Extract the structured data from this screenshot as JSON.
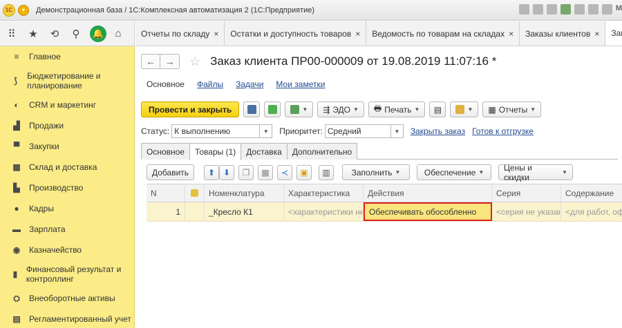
{
  "window": {
    "title": "Демонстрационная база / 1С:Комплексная автоматизация 2 (1С:Предприятие)",
    "logo_text": "1С",
    "tool_letter": "M"
  },
  "tabs": [
    {
      "label": "Отчеты по складу"
    },
    {
      "label": "Остатки и доступность товаров"
    },
    {
      "label": "Ведомость по товарам на складах"
    },
    {
      "label": "Заказы клиентов"
    },
    {
      "label": "Заказ клие"
    }
  ],
  "tab_close": "×",
  "sidebar": {
    "items": [
      {
        "label": "Главное",
        "icon": "≡"
      },
      {
        "label": "Бюджетирование и планирование",
        "icon": "⟆"
      },
      {
        "label": "CRM и маркетинг",
        "icon": "◐"
      },
      {
        "label": "Продажи",
        "icon": "▟"
      },
      {
        "label": "Закупки",
        "icon": "▀"
      },
      {
        "label": "Склад и доставка",
        "icon": "▦"
      },
      {
        "label": "Производство",
        "icon": "▙"
      },
      {
        "label": "Кадры",
        "icon": "●"
      },
      {
        "label": "Зарплата",
        "icon": "▬"
      },
      {
        "label": "Казначейство",
        "icon": "◉"
      },
      {
        "label": "Финансовый результат и контроллинг",
        "icon": "▮"
      },
      {
        "label": "Внеоборотные активы",
        "icon": "⛭"
      },
      {
        "label": "Регламентированный учет",
        "icon": "▤"
      }
    ]
  },
  "document": {
    "title": "Заказ клиента ПР00-000009 от 19.08.2019 11:07:16 *",
    "sublinks": {
      "current": "Основное",
      "links": [
        "Файлы",
        "Задачи",
        "Мои заметки"
      ]
    },
    "toolbar": {
      "post_close": "Провести и закрыть",
      "edo": "ЭДО",
      "print": "Печать",
      "reports": "Отчеты"
    },
    "status": {
      "status_label": "Статус:",
      "status_value": "К выполнению",
      "priority_label": "Приоритет:",
      "priority_value": "Средний",
      "close_order": "Закрыть заказ",
      "ready": "Готов к отгрузке"
    },
    "form_tabs": [
      "Основное",
      "Товары (1)",
      "Доставка",
      "Дополнительно"
    ],
    "goods_toolbar": {
      "add": "Добавить",
      "fill": "Заполнить",
      "provision": "Обеспечение",
      "prices": "Цены и скидки"
    },
    "table": {
      "columns": [
        "N",
        "",
        "Номенклатура",
        "Характеристика",
        "Действия",
        "Серия",
        "Содержание"
      ],
      "rows": [
        {
          "n": "1",
          "flag": "",
          "item": "_Кресло К1",
          "characteristic": "<характеристики не используются>",
          "action": "Обеспечивать обособленно",
          "series": "<серия не указана>",
          "content": "<для работ, оформляемых отдельно>"
        }
      ]
    }
  }
}
